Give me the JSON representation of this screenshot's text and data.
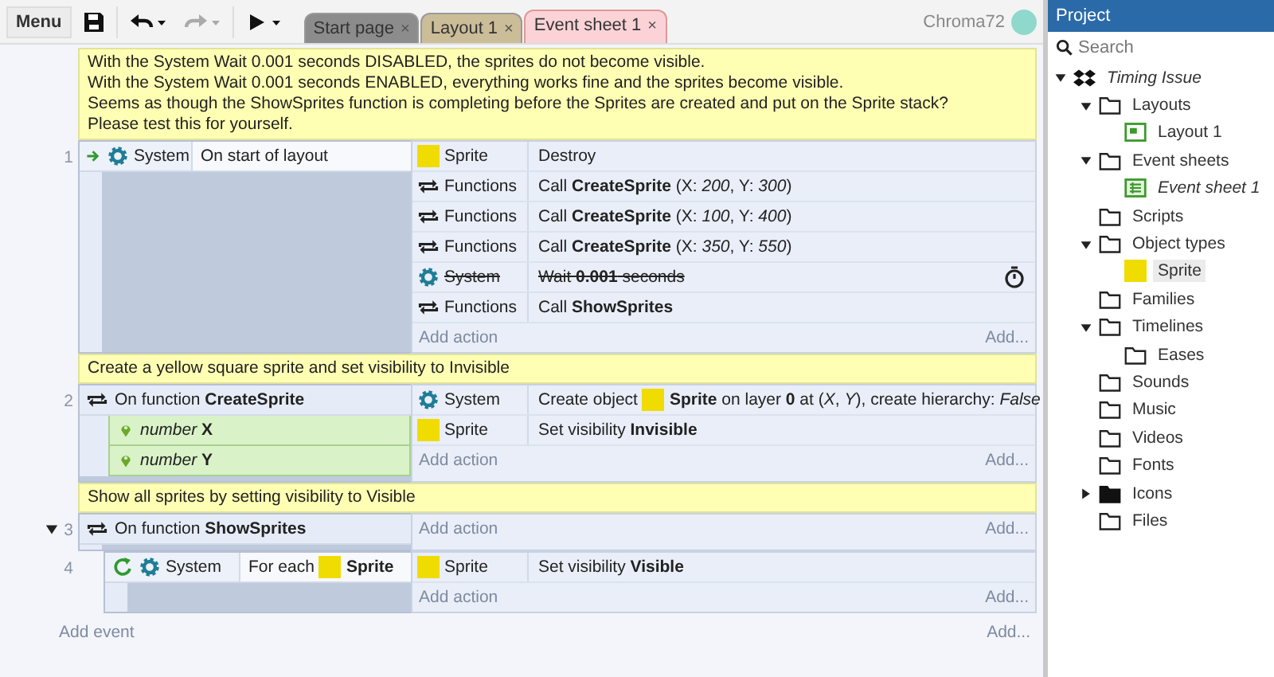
{
  "toolbar": {
    "menu": "Menu",
    "undo_enabled": true,
    "redo_enabled": false,
    "tabs": [
      {
        "label": "Start page",
        "close": "×",
        "selected": false,
        "color": "#8c8c8c"
      },
      {
        "label": "Layout 1",
        "close": "×",
        "selected": false,
        "color": "#cbbd98"
      },
      {
        "label": "Event sheet 1",
        "close": "×",
        "selected": true,
        "color": "#fbd3d7"
      }
    ],
    "user": "Chroma72"
  },
  "sheet": {
    "items": [
      {
        "kind": "comment",
        "lines": [
          "With the System Wait 0.001 seconds DISABLED, the sprites do not become visible.",
          "With the System Wait 0.001 seconds ENABLED, everything works fine and the sprites become visible.",
          "Seems as though the ShowSprites function is completing before the Sprites are created and put on the Sprite stack?",
          "Please test this for yourself."
        ]
      },
      {
        "kind": "event",
        "number": "1",
        "conditions": [
          {
            "kind": "trigger",
            "object": "System",
            "text": "On start of layout"
          }
        ],
        "actions": [
          {
            "kind": "sprite",
            "object": "Sprite",
            "text": "Destroy",
            "disabled": false,
            "async": false
          },
          {
            "kind": "functions",
            "object": "Functions",
            "text": "Call **CreateSprite** (X: *200*, Y: *300*)",
            "disabled": false,
            "async": false
          },
          {
            "kind": "functions",
            "object": "Functions",
            "text": "Call **CreateSprite** (X: *100*, Y: *400*)",
            "disabled": false,
            "async": false
          },
          {
            "kind": "functions",
            "object": "Functions",
            "text": "Call **CreateSprite** (X: *350*, Y: *550*)",
            "disabled": false,
            "async": false
          },
          {
            "kind": "system",
            "object": "System",
            "text": "Wait **0.001** seconds",
            "disabled": true,
            "async": true
          },
          {
            "kind": "functions",
            "object": "Functions",
            "text": "Call **ShowSprites**",
            "disabled": false,
            "async": false
          }
        ],
        "add_action": "Add action",
        "add": "Add..."
      },
      {
        "kind": "comment",
        "lines": [
          "Create a yellow square sprite and set visibility to Invisible"
        ]
      },
      {
        "kind": "event",
        "number": "2",
        "conditions": [
          {
            "kind": "function",
            "text": "On function **CreateSprite**"
          }
        ],
        "params": [
          {
            "text": "*number* **X**"
          },
          {
            "text": "*number* **Y**"
          }
        ],
        "actions": [
          {
            "kind": "system",
            "object": "System",
            "text_parts": [
              "Create object",
              "**Sprite** on layer **0** at (*X*, *Y*), create hierarchy: *False*"
            ],
            "disabled": false,
            "async": false
          },
          {
            "kind": "sprite",
            "object": "Sprite",
            "text": "Set visibility **Invisible**",
            "disabled": false,
            "async": false
          }
        ],
        "add_action": "Add action",
        "add": "Add..."
      },
      {
        "kind": "comment",
        "lines": [
          "Show all sprites by setting visibility to Visible"
        ]
      },
      {
        "kind": "event",
        "number": "3",
        "expanded": true,
        "conditions": [
          {
            "kind": "function",
            "text": "On function **ShowSprites**"
          }
        ],
        "add_action": "Add action",
        "add": "Add...",
        "children": [
          {
            "kind": "event",
            "number": "4",
            "conditions": [
              {
                "kind": "loop",
                "object": "System",
                "text_parts": [
                  "For each",
                  "**Sprite**"
                ]
              }
            ],
            "actions": [
              {
                "kind": "sprite",
                "object": "Sprite",
                "text": "Set visibility **Visible**",
                "disabled": false,
                "async": false
              }
            ],
            "add_action": "Add action",
            "add": "Add..."
          }
        ]
      }
    ],
    "add_event": "Add event",
    "add": "Add..."
  },
  "project": {
    "title": "Project",
    "search": {
      "placeholder": "Search"
    },
    "tree": [
      {
        "label": "Timing Issue",
        "kind": "project",
        "active": true,
        "selected": false,
        "expanded": true,
        "children": [
          {
            "label": "Layouts",
            "kind": "folder",
            "active": false,
            "selected": false,
            "expanded": true,
            "children": [
              {
                "label": "Layout 1",
                "kind": "layout",
                "active": false,
                "selected": false
              }
            ]
          },
          {
            "label": "Event sheets",
            "kind": "folder",
            "active": false,
            "selected": false,
            "expanded": true,
            "children": [
              {
                "label": "Event sheet 1",
                "kind": "eventsheet",
                "active": true,
                "selected": false
              }
            ]
          },
          {
            "label": "Scripts",
            "kind": "folder",
            "active": false,
            "selected": false
          },
          {
            "label": "Object types",
            "kind": "folder",
            "active": false,
            "selected": false,
            "expanded": true,
            "children": [
              {
                "label": "Sprite",
                "kind": "sprite",
                "active": false,
                "selected": true
              }
            ]
          },
          {
            "label": "Families",
            "kind": "folder",
            "active": false,
            "selected": false
          },
          {
            "label": "Timelines",
            "kind": "folder",
            "active": false,
            "selected": false,
            "expanded": true,
            "children": [
              {
                "label": "Eases",
                "kind": "folder",
                "active": false,
                "selected": false
              }
            ]
          },
          {
            "label": "Sounds",
            "kind": "folder",
            "active": false,
            "selected": false
          },
          {
            "label": "Music",
            "kind": "folder",
            "active": false,
            "selected": false
          },
          {
            "label": "Videos",
            "kind": "folder",
            "active": false,
            "selected": false
          },
          {
            "label": "Fonts",
            "kind": "folder",
            "active": false,
            "selected": false
          },
          {
            "label": "Icons",
            "kind": "folder-filled",
            "active": false,
            "selected": false,
            "expanded": false
          },
          {
            "label": "Files",
            "kind": "folder",
            "active": false,
            "selected": false
          }
        ]
      }
    ]
  }
}
